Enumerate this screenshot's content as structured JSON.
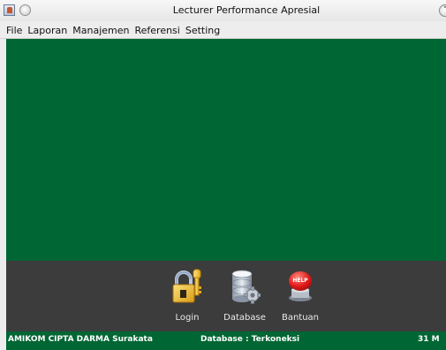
{
  "window": {
    "title": "Lecturer Performance Apresial"
  },
  "menu": [
    "File",
    "Laporan",
    "Manajemen",
    "Referensi",
    "Setting"
  ],
  "toolbar": {
    "login_label": "Login",
    "database_label": "Database",
    "bantuan_label": "Bantuan",
    "help_badge": "HELP"
  },
  "status": {
    "institution": "AMIKOM CIPTA DARMA Surakata",
    "database": "Database : Terkoneksi",
    "date": "31 M"
  },
  "colors": {
    "desktop": "#006633",
    "toolbar": "#3c3c3c",
    "status": "#006633"
  }
}
